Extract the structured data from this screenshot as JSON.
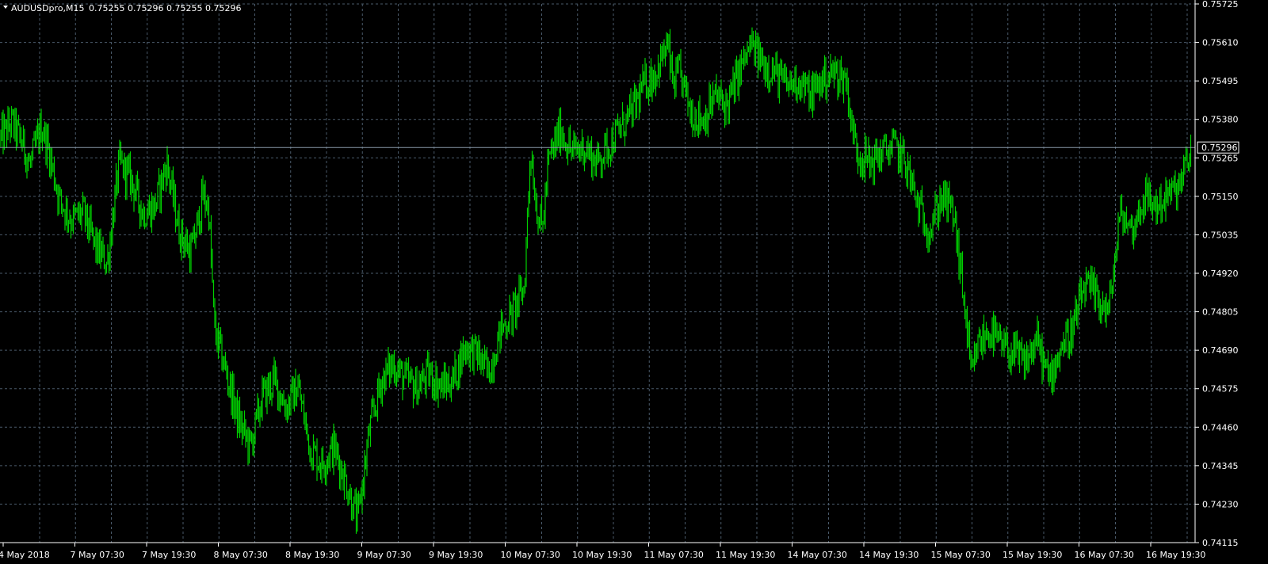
{
  "header": {
    "symbol_label": "AUDUSDpro,M15",
    "ohlc_text": "0.75255 0.75296 0.75255 0.75296"
  },
  "colors": {
    "background": "#000000",
    "grid": "#4a5a6a",
    "axis": "#ffffff",
    "text": "#ffffff",
    "bars": "#00d000",
    "price_line": "#8a9aaa"
  },
  "chart_data": {
    "type": "ohlc-bars",
    "title": "AUDUSDpro,M15",
    "ylim": [
      0.74115,
      0.75725
    ],
    "y_ticks": [
      "0.75725",
      "0.75610",
      "0.75495",
      "0.75380",
      "0.75265",
      "0.75150",
      "0.75035",
      "0.74920",
      "0.74805",
      "0.74690",
      "0.74575",
      "0.74460",
      "0.74345",
      "0.74230",
      "0.74115"
    ],
    "x_ticks": [
      "4 May 2018",
      "7 May 07:30",
      "7 May 19:30",
      "8 May 07:30",
      "8 May 19:30",
      "9 May 07:30",
      "9 May 19:30",
      "10 May 07:30",
      "10 May 19:30",
      "11 May 07:30",
      "11 May 19:30",
      "14 May 07:30",
      "14 May 19:30",
      "15 May 07:30",
      "15 May 19:30",
      "16 May 07:30",
      "16 May 19:30"
    ],
    "grid": true,
    "current_price": "0.75296",
    "close_path": [
      [
        0,
        0.7532
      ],
      [
        0.01,
        0.7537
      ],
      [
        0.02,
        0.753
      ],
      [
        0.025,
        0.7524
      ],
      [
        0.035,
        0.7536
      ],
      [
        0.04,
        0.753
      ],
      [
        0.05,
        0.7514
      ],
      [
        0.06,
        0.7508
      ],
      [
        0.07,
        0.751
      ],
      [
        0.08,
        0.75
      ],
      [
        0.09,
        0.7495
      ],
      [
        0.1,
        0.7525
      ],
      [
        0.11,
        0.752
      ],
      [
        0.12,
        0.751
      ],
      [
        0.13,
        0.7512
      ],
      [
        0.14,
        0.7525
      ],
      [
        0.15,
        0.7505
      ],
      [
        0.16,
        0.7498
      ],
      [
        0.165,
        0.7505
      ],
      [
        0.17,
        0.7515
      ],
      [
        0.175,
        0.7512
      ],
      [
        0.18,
        0.7475
      ],
      [
        0.19,
        0.7462
      ],
      [
        0.2,
        0.7448
      ],
      [
        0.21,
        0.744
      ],
      [
        0.22,
        0.7455
      ],
      [
        0.23,
        0.746
      ],
      [
        0.24,
        0.7452
      ],
      [
        0.25,
        0.7458
      ],
      [
        0.26,
        0.744
      ],
      [
        0.27,
        0.7435
      ],
      [
        0.28,
        0.744
      ],
      [
        0.29,
        0.743
      ],
      [
        0.3,
        0.7418
      ],
      [
        0.31,
        0.7445
      ],
      [
        0.32,
        0.746
      ],
      [
        0.33,
        0.7465
      ],
      [
        0.34,
        0.746
      ],
      [
        0.35,
        0.7458
      ],
      [
        0.36,
        0.7462
      ],
      [
        0.37,
        0.7458
      ],
      [
        0.38,
        0.746
      ],
      [
        0.39,
        0.747
      ],
      [
        0.4,
        0.7468
      ],
      [
        0.41,
        0.7462
      ],
      [
        0.42,
        0.7475
      ],
      [
        0.43,
        0.748
      ],
      [
        0.44,
        0.7488
      ],
      [
        0.445,
        0.753
      ],
      [
        0.45,
        0.7512
      ],
      [
        0.455,
        0.7505
      ],
      [
        0.46,
        0.7525
      ],
      [
        0.47,
        0.7535
      ],
      [
        0.48,
        0.7528
      ],
      [
        0.49,
        0.753
      ],
      [
        0.5,
        0.7525
      ],
      [
        0.51,
        0.753
      ],
      [
        0.52,
        0.7535
      ],
      [
        0.53,
        0.754
      ],
      [
        0.54,
        0.7548
      ],
      [
        0.55,
        0.7552
      ],
      [
        0.56,
        0.756
      ],
      [
        0.565,
        0.7548
      ],
      [
        0.57,
        0.7552
      ],
      [
        0.58,
        0.754
      ],
      [
        0.59,
        0.7538
      ],
      [
        0.6,
        0.7545
      ],
      [
        0.61,
        0.7542
      ],
      [
        0.62,
        0.7552
      ],
      [
        0.63,
        0.756
      ],
      [
        0.64,
        0.7555
      ],
      [
        0.65,
        0.7552
      ],
      [
        0.66,
        0.7548
      ],
      [
        0.67,
        0.755
      ],
      [
        0.68,
        0.7545
      ],
      [
        0.69,
        0.755
      ],
      [
        0.7,
        0.7552
      ],
      [
        0.71,
        0.755
      ],
      [
        0.715,
        0.7535
      ],
      [
        0.72,
        0.7528
      ],
      [
        0.73,
        0.7525
      ],
      [
        0.74,
        0.7528
      ],
      [
        0.75,
        0.753
      ],
      [
        0.76,
        0.7525
      ],
      [
        0.77,
        0.7512
      ],
      [
        0.78,
        0.7505
      ],
      [
        0.79,
        0.7515
      ],
      [
        0.8,
        0.751
      ],
      [
        0.81,
        0.748
      ],
      [
        0.815,
        0.746
      ],
      [
        0.82,
        0.747
      ],
      [
        0.83,
        0.7475
      ],
      [
        0.84,
        0.747
      ],
      [
        0.85,
        0.7468
      ],
      [
        0.86,
        0.7465
      ],
      [
        0.87,
        0.7472
      ],
      [
        0.88,
        0.746
      ],
      [
        0.885,
        0.7465
      ],
      [
        0.89,
        0.747
      ],
      [
        0.9,
        0.7475
      ],
      [
        0.91,
        0.7488
      ],
      [
        0.92,
        0.7485
      ],
      [
        0.93,
        0.748
      ],
      [
        0.935,
        0.7495
      ],
      [
        0.94,
        0.751
      ],
      [
        0.95,
        0.7505
      ],
      [
        0.96,
        0.7515
      ],
      [
        0.97,
        0.7512
      ],
      [
        0.98,
        0.7515
      ],
      [
        0.99,
        0.7518
      ],
      [
        1.0,
        0.75296
      ]
    ]
  }
}
